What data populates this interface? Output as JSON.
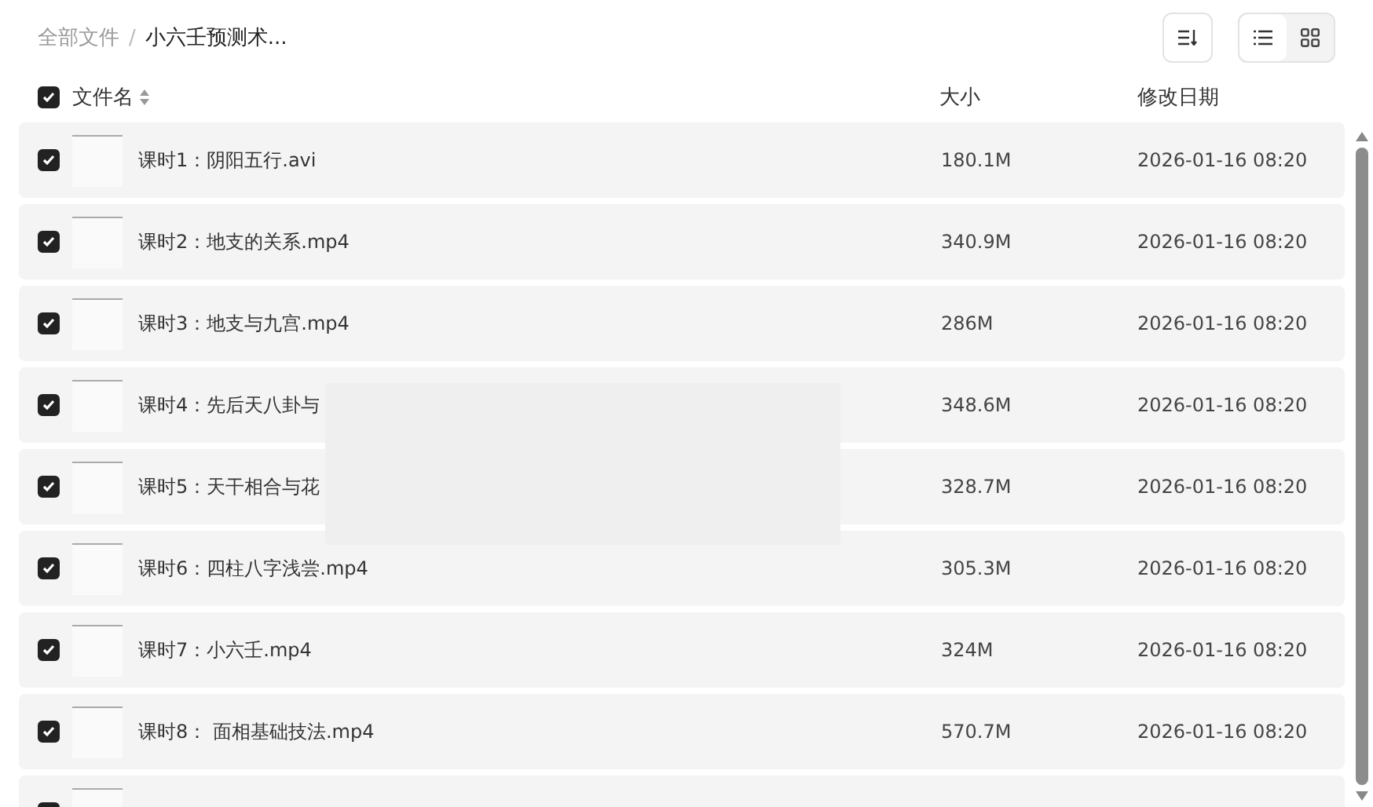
{
  "breadcrumb_separator": "/",
  "breadcrumb": [
    {
      "label": "全部文件",
      "current": false
    },
    {
      "label": "小六壬预测术...",
      "current": true
    }
  ],
  "view_toggle": [
    {
      "kind": "list",
      "selected": true
    },
    {
      "kind": "grid",
      "selected": false
    }
  ],
  "table": {
    "select_all": {
      "checked": true
    },
    "columns": [
      {
        "label": "文件名",
        "sortable": true
      },
      {
        "label": "大小",
        "sortable": false
      },
      {
        "label": "修改日期",
        "sortable": false
      }
    ],
    "rows": [
      {
        "checked": true,
        "name": "课时1：阴阳五行.avi",
        "size": "180.1M",
        "date": "2026-01-16 08:20"
      },
      {
        "checked": true,
        "name": "课时2：地支的关系.mp4",
        "size": "340.9M",
        "date": "2026-01-16 08:20"
      },
      {
        "checked": true,
        "name": "课时3：地支与九宫.mp4",
        "size": "286M",
        "date": "2026-01-16 08:20"
      },
      {
        "checked": true,
        "name": "课时4：先后天八卦与",
        "size": "348.6M",
        "date": "2026-01-16 08:20"
      },
      {
        "checked": true,
        "name": "课时5：天干相合与花",
        "size": "328.7M",
        "date": "2026-01-16 08:20"
      },
      {
        "checked": true,
        "name": "课时6：四柱八字浅尝.mp4",
        "size": "305.3M",
        "date": "2026-01-16 08:20"
      },
      {
        "checked": true,
        "name": "课时7：小六壬.mp4",
        "size": "324M",
        "date": "2026-01-16 08:20"
      },
      {
        "checked": true,
        "name": "课时8： 面相基础技法.mp4",
        "size": "570.7M",
        "date": "2026-01-16 08:20"
      },
      {
        "checked": true
      }
    ]
  }
}
